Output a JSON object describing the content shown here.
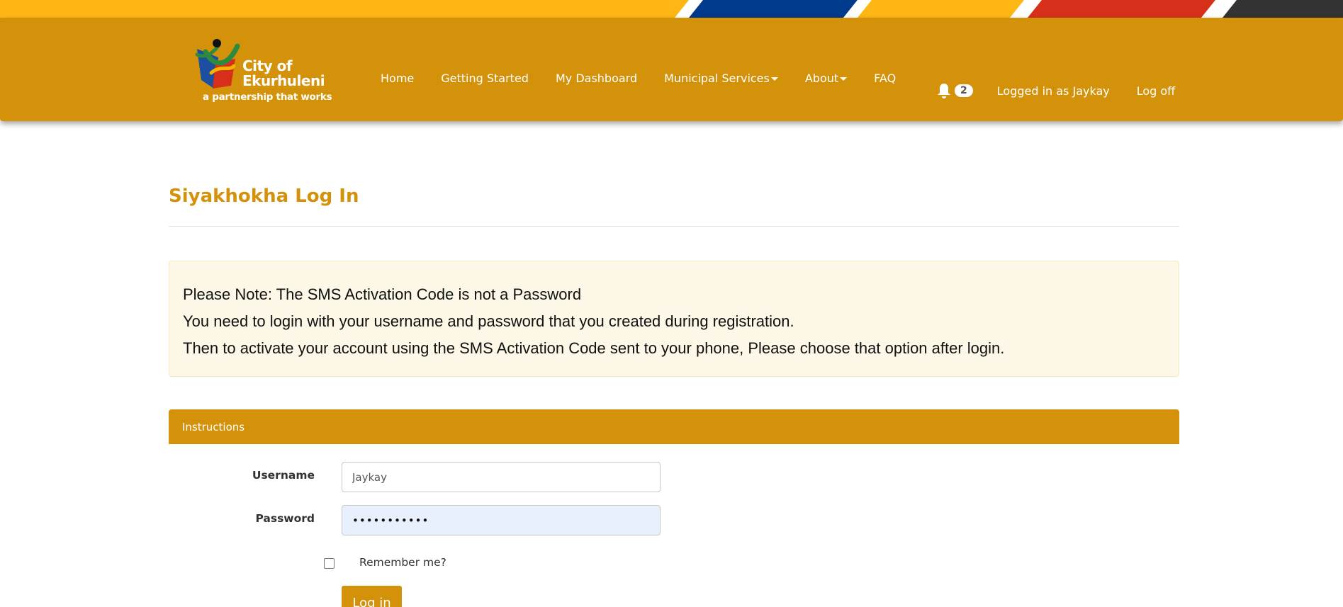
{
  "brand": {
    "name_line1": "City of",
    "name_line2": "Ekurhuleni",
    "tagline": "a partnership that works"
  },
  "nav": {
    "items": [
      {
        "label": "Home"
      },
      {
        "label": "Getting Started"
      },
      {
        "label": "My Dashboard"
      },
      {
        "label": "Municipal Services"
      },
      {
        "label": "About"
      },
      {
        "label": "FAQ"
      }
    ],
    "notification_count": "2",
    "logged_in_label": "Logged in as Jaykay",
    "logoff_label": "Log off"
  },
  "page": {
    "title": "Siyakhokha Log In"
  },
  "notice": {
    "line1": "Please Note: The SMS Activation Code is not a Password",
    "line2": "You need to login with your username and password that you created during registration.",
    "line3": "Then to activate your account using the SMS Activation Code sent to your phone, Please choose that option after login."
  },
  "form": {
    "panel_title": "Instructions",
    "username_label": "Username",
    "username_value": "Jaykay",
    "password_label": "Password",
    "password_value": "•••••••••••",
    "remember_label": "Remember me?",
    "submit_label": "Log in"
  },
  "colors": {
    "brand_gold": "#D4920A",
    "stripe_yellow": "#FDB614",
    "stripe_blue": "#003A8C",
    "stripe_red": "#D7301A",
    "stripe_dark": "#333333",
    "notice_bg": "#FCF7E6"
  },
  "icons": {
    "notification": "bell-icon",
    "menu_dropdown": "caret-down-icon"
  }
}
